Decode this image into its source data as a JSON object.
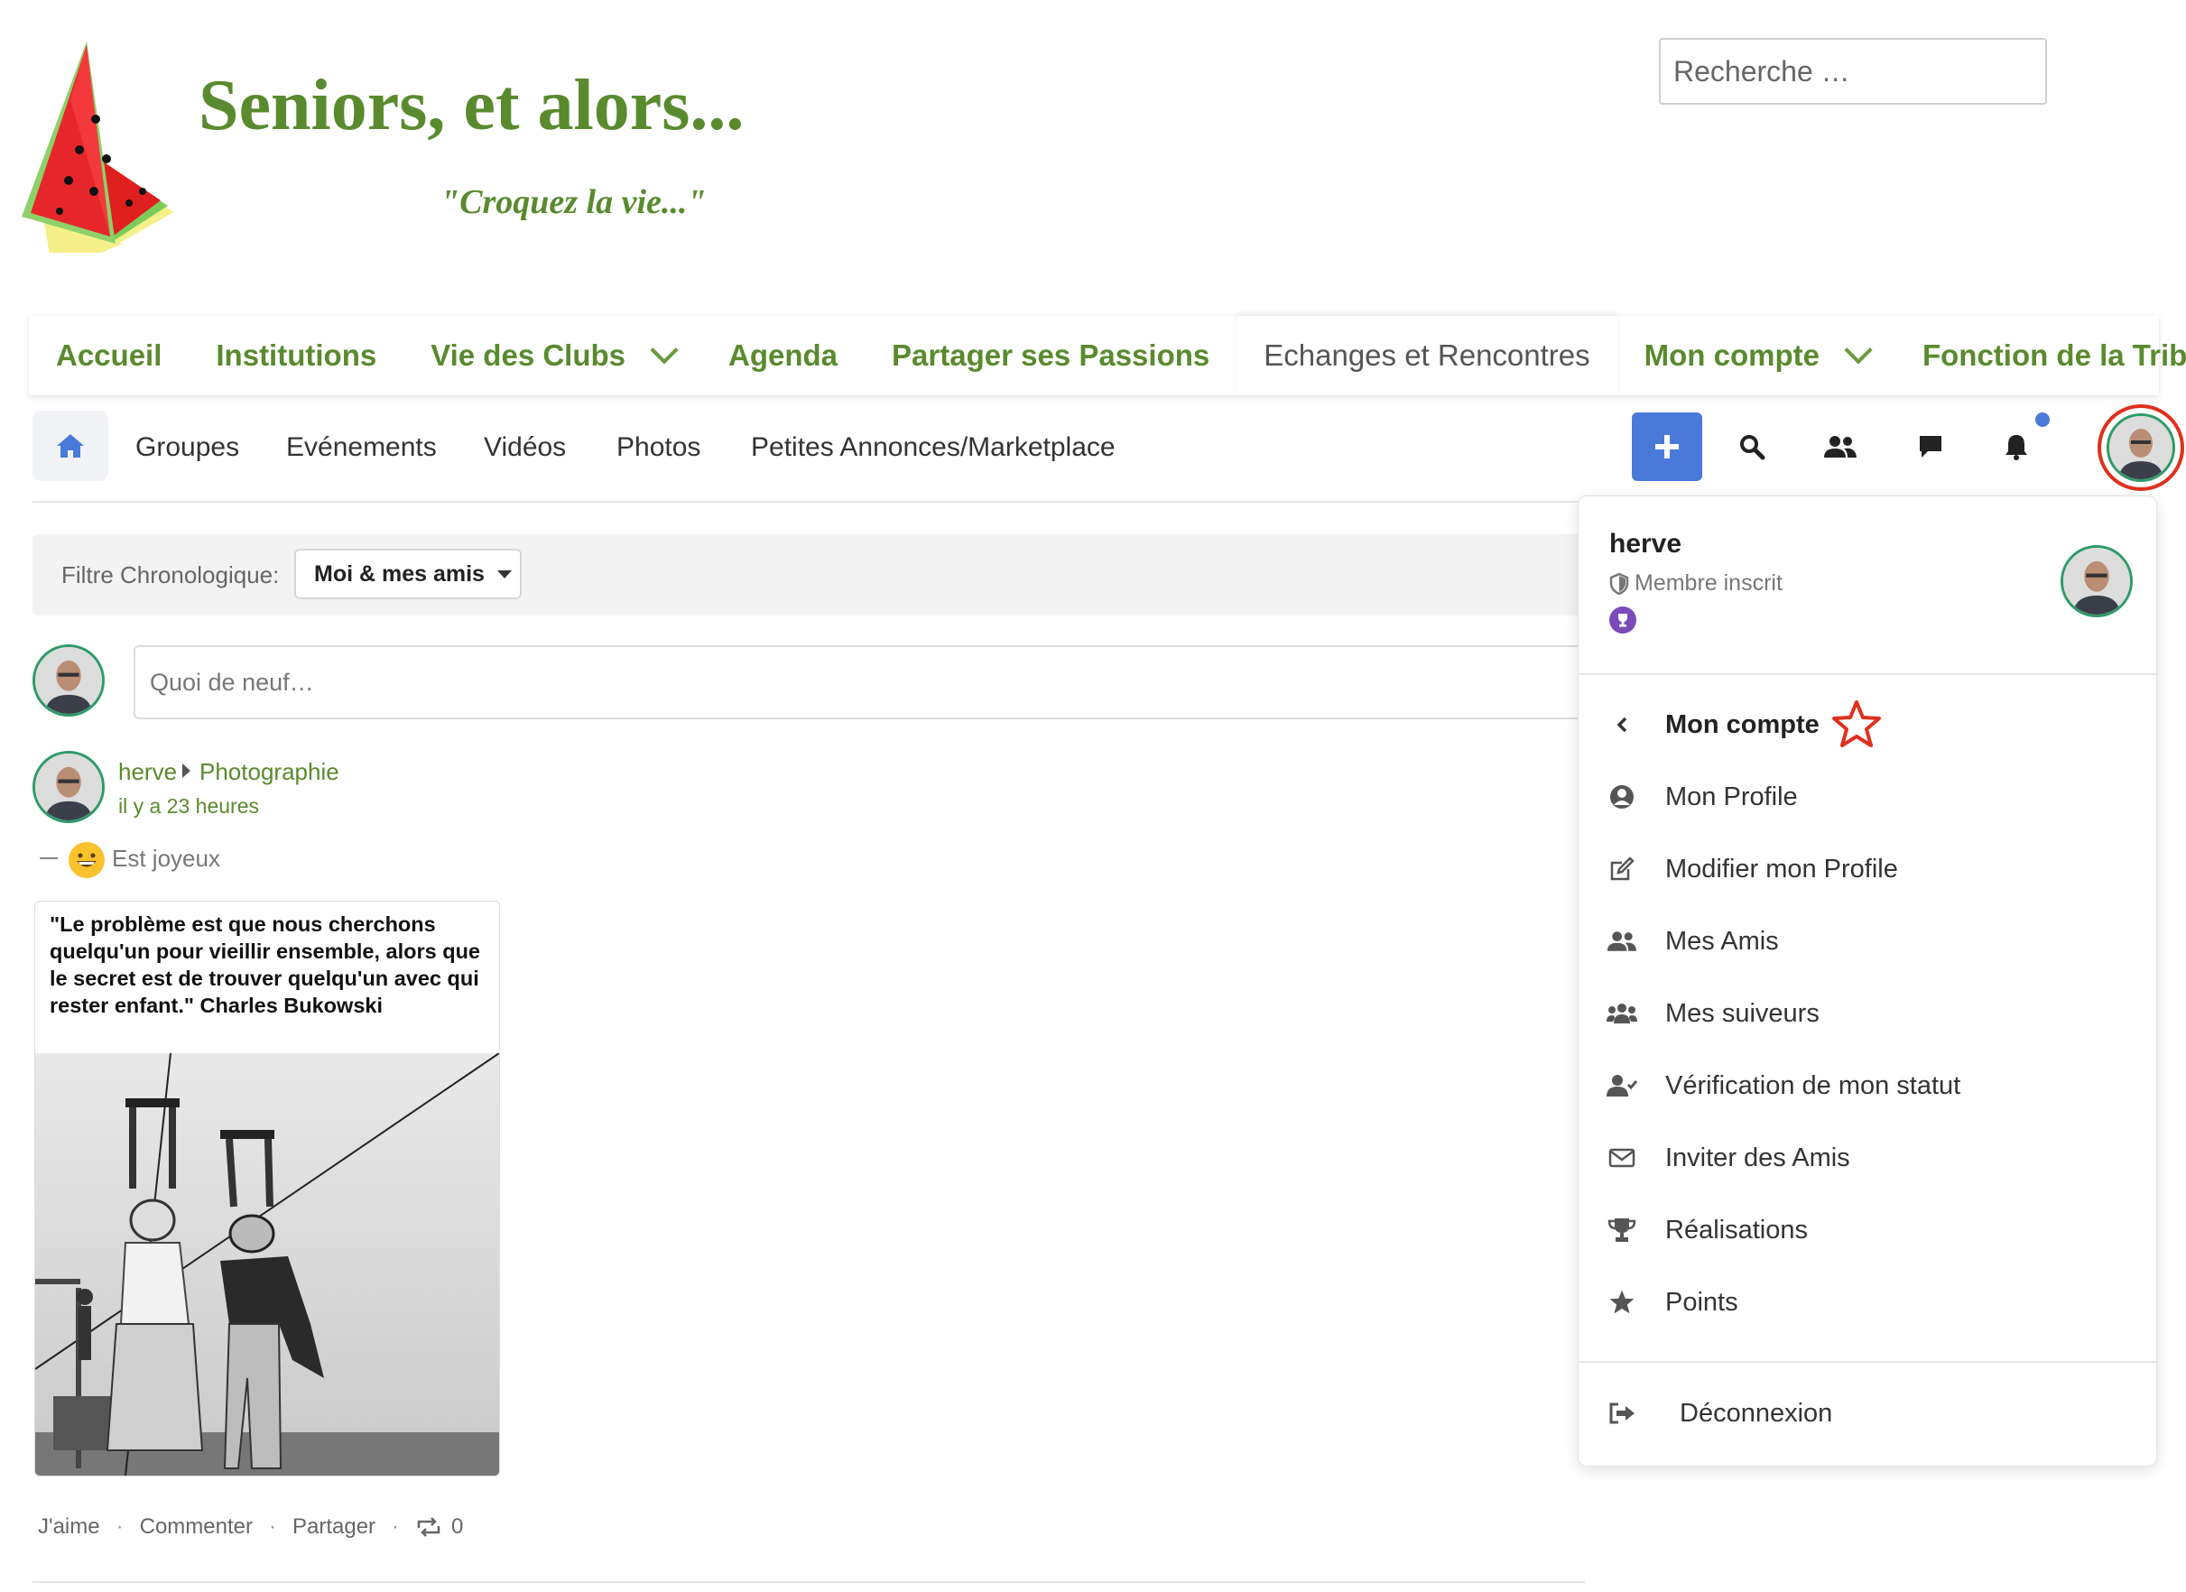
{
  "site": {
    "title": "Seniors, et alors...",
    "tagline": "\"Croquez la vie...\"",
    "search_placeholder": "Recherche …"
  },
  "main_nav": [
    {
      "label": "Accueil",
      "dropdown": false
    },
    {
      "label": "Institutions",
      "dropdown": false
    },
    {
      "label": "Vie des Clubs",
      "dropdown": true
    },
    {
      "label": "Agenda",
      "dropdown": false
    },
    {
      "label": "Partager ses Passions",
      "dropdown": false
    },
    {
      "label": "Echanges et Rencontres",
      "dropdown": false,
      "active": true
    },
    {
      "label": "Mon compte",
      "dropdown": true
    },
    {
      "label": "Fonction de la Tribu",
      "dropdown": true
    }
  ],
  "sub_nav": {
    "home_icon": "home-icon",
    "links": [
      "Groupes",
      "Evénements",
      "Vidéos",
      "Photos",
      "Petites Annonces/Marketplace"
    ],
    "icons": [
      "plus-icon",
      "search-icon",
      "friends-icon",
      "messages-icon",
      "bell-icon"
    ]
  },
  "filter": {
    "label": "Filtre Chronologique:",
    "selected": "Moi & mes amis"
  },
  "composer": {
    "placeholder": "Quoi de neuf…"
  },
  "post": {
    "author": "herve",
    "group": "Photographie",
    "time": "il y a 23 heures",
    "mood": "Est joyeux",
    "quote": "\"Le problème est que nous cherchons quelqu'un pour vieillir ensemble, alors que le secret est de trouver quelqu'un avec qui rester enfant.\" Charles Bukowski",
    "actions": {
      "like": "J'aime",
      "comment": "Commenter",
      "share": "Partager",
      "repost_count": "0"
    }
  },
  "dropdown": {
    "username": "herve",
    "role": "Membre inscrit",
    "header_item": "Mon compte",
    "items": [
      {
        "label": "Mon Profile",
        "icon": "user-circle-icon"
      },
      {
        "label": "Modifier mon Profile",
        "icon": "edit-icon"
      },
      {
        "label": "Mes Amis",
        "icon": "friends-icon"
      },
      {
        "label": "Mes suiveurs",
        "icon": "followers-icon"
      },
      {
        "label": "Vérification de mon statut",
        "icon": "user-check-icon"
      },
      {
        "label": "Inviter des Amis",
        "icon": "envelope-icon"
      },
      {
        "label": "Réalisations",
        "icon": "trophy-icon"
      },
      {
        "label": "Points",
        "icon": "star-icon"
      }
    ],
    "logout": "Déconnexion"
  },
  "colors": {
    "brand_green": "#5a8a2e",
    "accent_blue": "#4a7ad9",
    "highlight_red": "#e0301e"
  }
}
